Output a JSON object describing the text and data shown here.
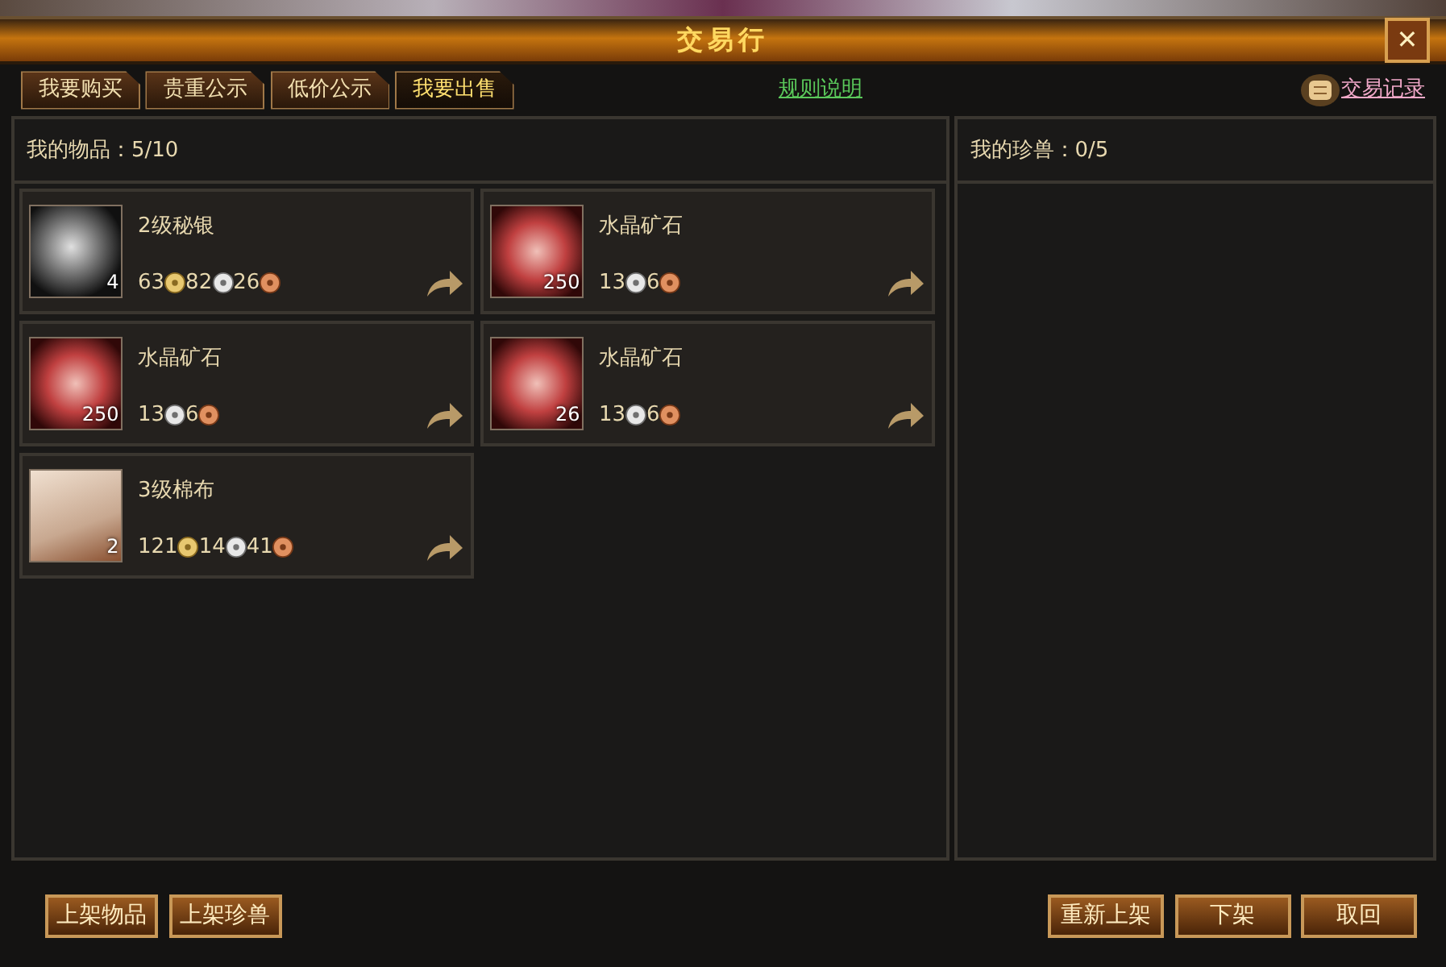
{
  "window": {
    "title": "交易行",
    "close": "✕"
  },
  "tabs": [
    {
      "label": "我要购买",
      "selected": false
    },
    {
      "label": "贵重公示",
      "selected": false
    },
    {
      "label": "低价公示",
      "selected": false
    },
    {
      "label": "我要出售",
      "selected": true
    }
  ],
  "rules_link": "规则说明",
  "history_link": "交易记录",
  "my_items": {
    "label": "我的物品：5/10",
    "items": [
      {
        "name": "2级秘银",
        "kind": "ore",
        "count": "4",
        "prices": [
          {
            "amount": "63",
            "kind": "gold"
          },
          {
            "amount": "82",
            "kind": "silver"
          },
          {
            "amount": "26",
            "kind": "copper"
          }
        ]
      },
      {
        "name": "水晶矿石",
        "kind": "crystal",
        "count": "250",
        "prices": [
          {
            "amount": "13",
            "kind": "silver"
          },
          {
            "amount": "6",
            "kind": "copper"
          }
        ]
      },
      {
        "name": "水晶矿石",
        "kind": "crystal",
        "count": "250",
        "prices": [
          {
            "amount": "13",
            "kind": "silver"
          },
          {
            "amount": "6",
            "kind": "copper"
          }
        ]
      },
      {
        "name": "水晶矿石",
        "kind": "crystal",
        "count": "26",
        "prices": [
          {
            "amount": "13",
            "kind": "silver"
          },
          {
            "amount": "6",
            "kind": "copper"
          }
        ]
      },
      {
        "name": "3级棉布",
        "kind": "cloth",
        "count": "2",
        "prices": [
          {
            "amount": "121",
            "kind": "gold"
          },
          {
            "amount": "14",
            "kind": "silver"
          },
          {
            "amount": "41",
            "kind": "copper"
          }
        ]
      }
    ]
  },
  "my_pets": {
    "label": "我的珍兽：0/5"
  },
  "left_buttons": [
    "上架物品",
    "上架珍兽"
  ],
  "right_buttons": [
    "重新上架",
    "下架",
    "取回"
  ]
}
